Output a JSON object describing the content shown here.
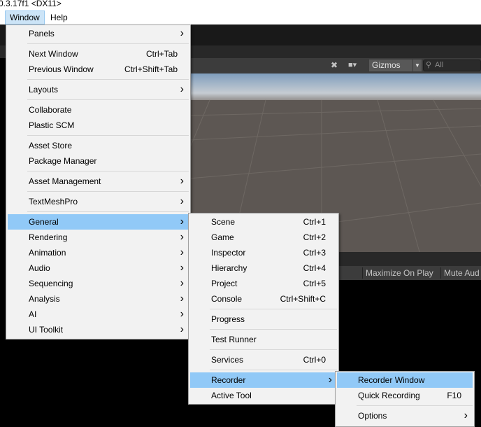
{
  "titlebar": {
    "text": "0.3.17f1 <DX11>"
  },
  "menubar": {
    "items": [
      "Window",
      "Help"
    ]
  },
  "scene_toolbar": {
    "gizmos_label": "Gizmos",
    "search_placeholder": "All"
  },
  "game_toolbar": {
    "maximize_label": "Maximize On Play",
    "mute_label": "Mute Aud"
  },
  "window_menu": {
    "items": [
      {
        "label": "Panels",
        "shortcut": "",
        "submenu": true
      },
      {
        "label": "Next Window",
        "shortcut": "Ctrl+Tab",
        "submenu": false
      },
      {
        "label": "Previous Window",
        "shortcut": "Ctrl+Shift+Tab",
        "submenu": false
      },
      {
        "label": "Layouts",
        "shortcut": "",
        "submenu": true
      },
      {
        "label": "Collaborate",
        "shortcut": "",
        "submenu": false
      },
      {
        "label": "Plastic SCM",
        "shortcut": "",
        "submenu": false
      },
      {
        "label": "Asset Store",
        "shortcut": "",
        "submenu": false
      },
      {
        "label": "Package Manager",
        "shortcut": "",
        "submenu": false
      },
      {
        "label": "Asset Management",
        "shortcut": "",
        "submenu": true
      },
      {
        "label": "TextMeshPro",
        "shortcut": "",
        "submenu": true
      },
      {
        "label": "General",
        "shortcut": "",
        "submenu": true,
        "highlighted": true
      },
      {
        "label": "Rendering",
        "shortcut": "",
        "submenu": true
      },
      {
        "label": "Animation",
        "shortcut": "",
        "submenu": true
      },
      {
        "label": "Audio",
        "shortcut": "",
        "submenu": true
      },
      {
        "label": "Sequencing",
        "shortcut": "",
        "submenu": true
      },
      {
        "label": "Analysis",
        "shortcut": "",
        "submenu": true
      },
      {
        "label": "AI",
        "shortcut": "",
        "submenu": true
      },
      {
        "label": "UI Toolkit",
        "shortcut": "",
        "submenu": true
      }
    ]
  },
  "general_menu": {
    "items": [
      {
        "label": "Scene",
        "shortcut": "Ctrl+1",
        "submenu": false
      },
      {
        "label": "Game",
        "shortcut": "Ctrl+2",
        "submenu": false
      },
      {
        "label": "Inspector",
        "shortcut": "Ctrl+3",
        "submenu": false
      },
      {
        "label": "Hierarchy",
        "shortcut": "Ctrl+4",
        "submenu": false
      },
      {
        "label": "Project",
        "shortcut": "Ctrl+5",
        "submenu": false
      },
      {
        "label": "Console",
        "shortcut": "Ctrl+Shift+C",
        "submenu": false
      },
      {
        "label": "Progress",
        "shortcut": "",
        "submenu": false
      },
      {
        "label": "Test Runner",
        "shortcut": "",
        "submenu": false
      },
      {
        "label": "Services",
        "shortcut": "Ctrl+0",
        "submenu": false
      },
      {
        "label": "Recorder",
        "shortcut": "",
        "submenu": true,
        "highlighted": true
      },
      {
        "label": "Active Tool",
        "shortcut": "",
        "submenu": false
      }
    ]
  },
  "recorder_menu": {
    "items": [
      {
        "label": "Recorder Window",
        "shortcut": "",
        "submenu": false,
        "highlighted": true
      },
      {
        "label": "Quick Recording",
        "shortcut": "F10",
        "submenu": false
      },
      {
        "label": "Options",
        "shortcut": "",
        "submenu": true
      }
    ]
  },
  "icons": {
    "submenu_arrow": "chevron-right-icon",
    "tools": "wrench-icon",
    "camera": "camera-icon",
    "search": "search-icon"
  },
  "colors": {
    "highlight": "#91c9f7",
    "menu_bg": "#f2f2f2",
    "editor_dark": "#191919"
  }
}
